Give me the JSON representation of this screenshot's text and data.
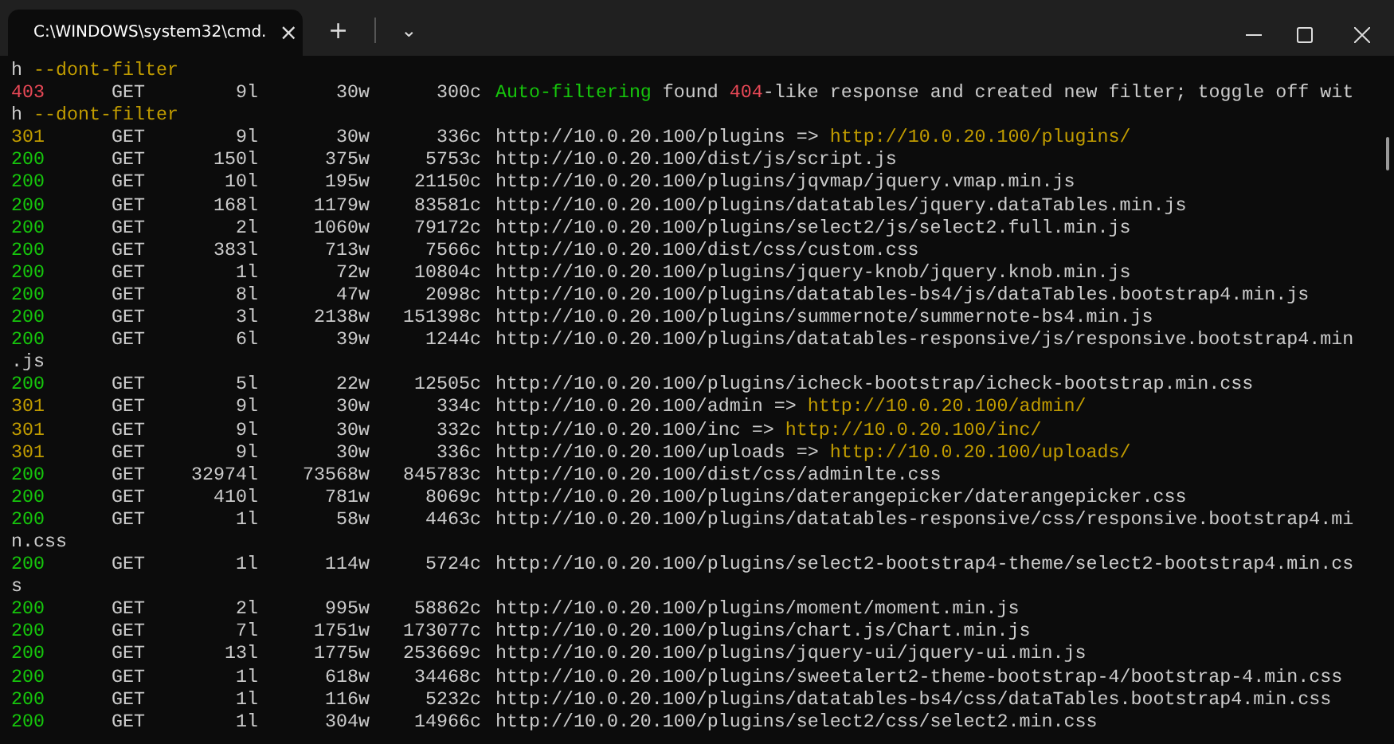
{
  "window": {
    "tab_title": "C:\\WINDOWS\\system32\\cmd.",
    "tab_close": "×",
    "new_tab": "+",
    "dropdown": "⌄"
  },
  "lines": [
    {
      "kind": "text",
      "segments": [
        {
          "text": "h ",
          "color": "#cccccc"
        },
        {
          "text": "--dont-filter",
          "color": "#c19c00"
        }
      ]
    },
    {
      "kind": "result",
      "status": "403",
      "color": "#e74856",
      "method": "GET",
      "lines": "9l",
      "words": "30w",
      "chars": "300c",
      "segments": [
        {
          "text": "Auto-filtering",
          "color": "#16c60c"
        },
        {
          "text": " found ",
          "color": "#cccccc"
        },
        {
          "text": "404",
          "color": "#e74856"
        },
        {
          "text": "-like response and created new filter; toggle off wit",
          "color": "#cccccc"
        }
      ]
    },
    {
      "kind": "text",
      "segments": [
        {
          "text": "h ",
          "color": "#cccccc"
        },
        {
          "text": "--dont-filter",
          "color": "#c19c00"
        }
      ]
    },
    {
      "kind": "result",
      "status": "301",
      "color": "#c19c00",
      "method": "GET",
      "lines": "9l",
      "words": "30w",
      "chars": "336c",
      "segments": [
        {
          "text": "http://10.0.20.100/plugins => ",
          "color": "#cccccc"
        },
        {
          "text": "http://10.0.20.100/plugins/",
          "color": "#c19c00"
        }
      ]
    },
    {
      "kind": "result",
      "status": "200",
      "color": "#16c60c",
      "method": "GET",
      "lines": "150l",
      "words": "375w",
      "chars": "5753c",
      "segments": [
        {
          "text": "http://10.0.20.100/dist/js/script.js",
          "color": "#cccccc"
        }
      ]
    },
    {
      "kind": "result",
      "status": "200",
      "color": "#16c60c",
      "method": "GET",
      "lines": "10l",
      "words": "195w",
      "chars": "21150c",
      "segments": [
        {
          "text": "http://10.0.20.100/plugins/jqvmap/jquery.vmap.min.js",
          "color": "#cccccc"
        }
      ]
    },
    {
      "kind": "result",
      "status": "200",
      "color": "#16c60c",
      "method": "GET",
      "lines": "168l",
      "words": "1179w",
      "chars": "83581c",
      "segments": [
        {
          "text": "http://10.0.20.100/plugins/datatables/jquery.dataTables.min.js",
          "color": "#cccccc"
        }
      ]
    },
    {
      "kind": "result",
      "status": "200",
      "color": "#16c60c",
      "method": "GET",
      "lines": "2l",
      "words": "1060w",
      "chars": "79172c",
      "segments": [
        {
          "text": "http://10.0.20.100/plugins/select2/js/select2.full.min.js",
          "color": "#cccccc"
        }
      ]
    },
    {
      "kind": "result",
      "status": "200",
      "color": "#16c60c",
      "method": "GET",
      "lines": "383l",
      "words": "713w",
      "chars": "7566c",
      "segments": [
        {
          "text": "http://10.0.20.100/dist/css/custom.css",
          "color": "#cccccc"
        }
      ]
    },
    {
      "kind": "result",
      "status": "200",
      "color": "#16c60c",
      "method": "GET",
      "lines": "1l",
      "words": "72w",
      "chars": "10804c",
      "segments": [
        {
          "text": "http://10.0.20.100/plugins/jquery-knob/jquery.knob.min.js",
          "color": "#cccccc"
        }
      ]
    },
    {
      "kind": "result",
      "status": "200",
      "color": "#16c60c",
      "method": "GET",
      "lines": "8l",
      "words": "47w",
      "chars": "2098c",
      "segments": [
        {
          "text": "http://10.0.20.100/plugins/datatables-bs4/js/dataTables.bootstrap4.min.js",
          "color": "#cccccc"
        }
      ]
    },
    {
      "kind": "result",
      "status": "200",
      "color": "#16c60c",
      "method": "GET",
      "lines": "3l",
      "words": "2138w",
      "chars": "151398c",
      "segments": [
        {
          "text": "http://10.0.20.100/plugins/summernote/summernote-bs4.min.js",
          "color": "#cccccc"
        }
      ]
    },
    {
      "kind": "result",
      "status": "200",
      "color": "#16c60c",
      "method": "GET",
      "lines": "6l",
      "words": "39w",
      "chars": "1244c",
      "segments": [
        {
          "text": "http://10.0.20.100/plugins/datatables-responsive/js/responsive.bootstrap4.min",
          "color": "#cccccc"
        }
      ]
    },
    {
      "kind": "text",
      "segments": [
        {
          "text": ".js",
          "color": "#cccccc"
        }
      ]
    },
    {
      "kind": "result",
      "status": "200",
      "color": "#16c60c",
      "method": "GET",
      "lines": "5l",
      "words": "22w",
      "chars": "12505c",
      "segments": [
        {
          "text": "http://10.0.20.100/plugins/icheck-bootstrap/icheck-bootstrap.min.css",
          "color": "#cccccc"
        }
      ]
    },
    {
      "kind": "result",
      "status": "301",
      "color": "#c19c00",
      "method": "GET",
      "lines": "9l",
      "words": "30w",
      "chars": "334c",
      "segments": [
        {
          "text": "http://10.0.20.100/admin => ",
          "color": "#cccccc"
        },
        {
          "text": "http://10.0.20.100/admin/",
          "color": "#c19c00"
        }
      ]
    },
    {
      "kind": "result",
      "status": "301",
      "color": "#c19c00",
      "method": "GET",
      "lines": "9l",
      "words": "30w",
      "chars": "332c",
      "segments": [
        {
          "text": "http://10.0.20.100/inc => ",
          "color": "#cccccc"
        },
        {
          "text": "http://10.0.20.100/inc/",
          "color": "#c19c00"
        }
      ]
    },
    {
      "kind": "result",
      "status": "301",
      "color": "#c19c00",
      "method": "GET",
      "lines": "9l",
      "words": "30w",
      "chars": "336c",
      "segments": [
        {
          "text": "http://10.0.20.100/uploads => ",
          "color": "#cccccc"
        },
        {
          "text": "http://10.0.20.100/uploads/",
          "color": "#c19c00"
        }
      ]
    },
    {
      "kind": "result",
      "status": "200",
      "color": "#16c60c",
      "method": "GET",
      "lines": "32974l",
      "words": "73568w",
      "chars": "845783c",
      "segments": [
        {
          "text": "http://10.0.20.100/dist/css/adminlte.css",
          "color": "#cccccc"
        }
      ]
    },
    {
      "kind": "result",
      "status": "200",
      "color": "#16c60c",
      "method": "GET",
      "lines": "410l",
      "words": "781w",
      "chars": "8069c",
      "segments": [
        {
          "text": "http://10.0.20.100/plugins/daterangepicker/daterangepicker.css",
          "color": "#cccccc"
        }
      ]
    },
    {
      "kind": "result",
      "status": "200",
      "color": "#16c60c",
      "method": "GET",
      "lines": "1l",
      "words": "58w",
      "chars": "4463c",
      "segments": [
        {
          "text": "http://10.0.20.100/plugins/datatables-responsive/css/responsive.bootstrap4.mi",
          "color": "#cccccc"
        }
      ]
    },
    {
      "kind": "text",
      "segments": [
        {
          "text": "n.css",
          "color": "#cccccc"
        }
      ]
    },
    {
      "kind": "result",
      "status": "200",
      "color": "#16c60c",
      "method": "GET",
      "lines": "1l",
      "words": "114w",
      "chars": "5724c",
      "segments": [
        {
          "text": "http://10.0.20.100/plugins/select2-bootstrap4-theme/select2-bootstrap4.min.cs",
          "color": "#cccccc"
        }
      ]
    },
    {
      "kind": "text",
      "segments": [
        {
          "text": "s",
          "color": "#cccccc"
        }
      ]
    },
    {
      "kind": "result",
      "status": "200",
      "color": "#16c60c",
      "method": "GET",
      "lines": "2l",
      "words": "995w",
      "chars": "58862c",
      "segments": [
        {
          "text": "http://10.0.20.100/plugins/moment/moment.min.js",
          "color": "#cccccc"
        }
      ]
    },
    {
      "kind": "result",
      "status": "200",
      "color": "#16c60c",
      "method": "GET",
      "lines": "7l",
      "words": "1751w",
      "chars": "173077c",
      "segments": [
        {
          "text": "http://10.0.20.100/plugins/chart.js/Chart.min.js",
          "color": "#cccccc"
        }
      ]
    },
    {
      "kind": "result",
      "status": "200",
      "color": "#16c60c",
      "method": "GET",
      "lines": "13l",
      "words": "1775w",
      "chars": "253669c",
      "segments": [
        {
          "text": "http://10.0.20.100/plugins/jquery-ui/jquery-ui.min.js",
          "color": "#cccccc"
        }
      ]
    },
    {
      "kind": "result",
      "status": "200",
      "color": "#16c60c",
      "method": "GET",
      "lines": "1l",
      "words": "618w",
      "chars": "34468c",
      "segments": [
        {
          "text": "http://10.0.20.100/plugins/sweetalert2-theme-bootstrap-4/bootstrap-4.min.css",
          "color": "#cccccc"
        }
      ]
    },
    {
      "kind": "result",
      "status": "200",
      "color": "#16c60c",
      "method": "GET",
      "lines": "1l",
      "words": "116w",
      "chars": "5232c",
      "segments": [
        {
          "text": "http://10.0.20.100/plugins/datatables-bs4/css/dataTables.bootstrap4.min.css",
          "color": "#cccccc"
        }
      ]
    },
    {
      "kind": "result",
      "status": "200",
      "color": "#16c60c",
      "method": "GET",
      "lines": "1l",
      "words": "304w",
      "chars": "14966c",
      "segments": [
        {
          "text": "http://10.0.20.100/plugins/select2/css/select2.min.css",
          "color": "#cccccc"
        }
      ]
    }
  ]
}
